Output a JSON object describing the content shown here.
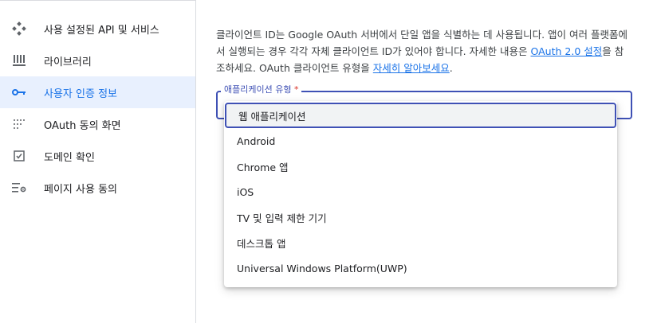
{
  "sidebar": {
    "items": [
      {
        "label": "사용 설정된 API 및 서비스",
        "icon": "api-diamond-icon"
      },
      {
        "label": "라이브러리",
        "icon": "library-icon"
      },
      {
        "label": "사용자 인증 정보",
        "icon": "key-icon",
        "active": true
      },
      {
        "label": "OAuth 동의 화면",
        "icon": "dots-grid-icon"
      },
      {
        "label": "도메인 확인",
        "icon": "checkbox-icon"
      },
      {
        "label": "페이지 사용 동의",
        "icon": "settings-list-icon"
      }
    ]
  },
  "main": {
    "description": {
      "part1": "클라이언트 ID는 Google OAuth 서버에서 단일 앱을 식별하는 데 사용됩니다. 앱이 여러 플랫폼에서 실행되는 경우 각각 자체 클라이언트 ID가 있어야 합니다. 자세한 내용은 ",
      "link1": "OAuth 2.0 설정",
      "part2": "을 참조하세요. OAuth 클라이언트 유형을 ",
      "link2": "자세히 알아보세요",
      "part3": "."
    },
    "app_type_select": {
      "label": "애플리케이션 유형",
      "required_mark": "*",
      "options": [
        {
          "label": "웹 애플리케이션",
          "selected": true
        },
        {
          "label": "Android"
        },
        {
          "label": "Chrome 앱"
        },
        {
          "label": "iOS"
        },
        {
          "label": "TV 및 입력 제한 기기"
        },
        {
          "label": "데스크톱 앱"
        },
        {
          "label": "Universal Windows Platform(UWP)"
        }
      ]
    }
  },
  "colors": {
    "accent": "#3f51b5",
    "link": "#1a73e8",
    "active_bg": "#e8f0fe",
    "required": "#d93025"
  }
}
